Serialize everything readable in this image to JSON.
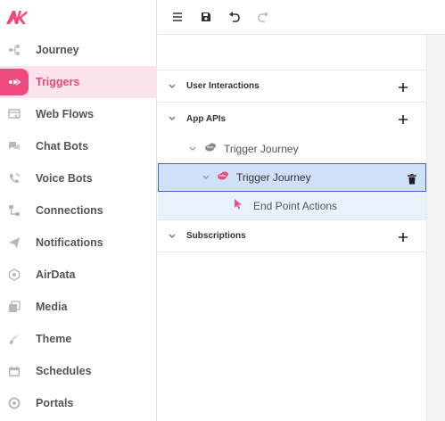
{
  "app": {
    "logo_text": "AK",
    "brand_color": "#ef4a80"
  },
  "sidebar": {
    "items": [
      {
        "label": "Journey",
        "icon": "journey-icon"
      },
      {
        "label": "Triggers",
        "icon": "triggers-icon",
        "active": true
      },
      {
        "label": "Web Flows",
        "icon": "web-flows-icon"
      },
      {
        "label": "Chat Bots",
        "icon": "chat-bots-icon"
      },
      {
        "label": "Voice Bots",
        "icon": "voice-bots-icon"
      },
      {
        "label": "Connections",
        "icon": "connections-icon"
      },
      {
        "label": "Notifications",
        "icon": "notifications-icon"
      },
      {
        "label": "AirData",
        "icon": "airdata-icon"
      },
      {
        "label": "Media",
        "icon": "media-icon"
      },
      {
        "label": "Theme",
        "icon": "theme-icon"
      },
      {
        "label": "Schedules",
        "icon": "schedules-icon"
      },
      {
        "label": "Portals",
        "icon": "portals-icon"
      }
    ]
  },
  "toolbar": {
    "buttons": [
      "menu-icon",
      "save-icon",
      "undo-icon",
      "redo-icon"
    ]
  },
  "tree": {
    "sections": [
      {
        "title": "User Interactions",
        "expanded": false
      },
      {
        "title": "App APIs",
        "expanded": true
      },
      {
        "title": "Subscriptions",
        "expanded": false
      }
    ],
    "app_apis": {
      "group_label": "Trigger Journey",
      "selected_label": "Trigger Journey",
      "child_label": "End Point Actions"
    }
  }
}
